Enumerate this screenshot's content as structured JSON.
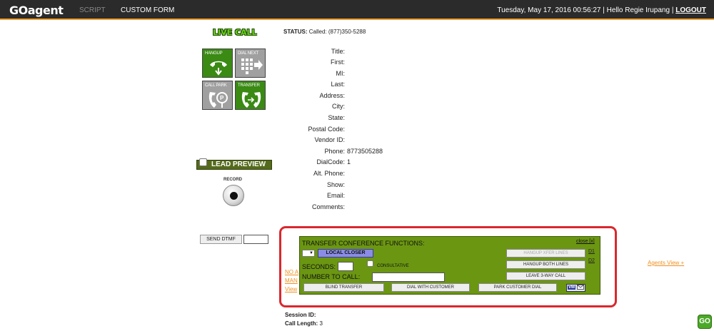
{
  "header": {
    "logo": "GOagent",
    "nav": {
      "script": "SCRIPT",
      "custom_form": "CUSTOM FORM"
    },
    "datetime": "Tuesday, May 17, 2016 00:56:27",
    "separator": "|",
    "greeting": "Hello Regie Irupang",
    "logout": "LOGOUT"
  },
  "call_status": {
    "badge": "LIVE CALL",
    "status_label": "STATUS:",
    "status_value": "Called: (877)350-5288"
  },
  "call_buttons": [
    {
      "label": "HANGUP",
      "icon": "hangup-phone-icon",
      "enabled": true
    },
    {
      "label": "DIAL NEXT",
      "icon": "dial-next-icon",
      "enabled": false
    },
    {
      "label": "CALL PARK",
      "icon": "call-park-icon",
      "enabled": false
    },
    {
      "label": "TRANSFER",
      "icon": "transfer-call-icon",
      "enabled": true
    }
  ],
  "lead_preview_label": "LEAD PREVIEW",
  "record_label": "RECORD",
  "send_dtmf_label": "SEND DTMF",
  "lead_fields": [
    {
      "label": "Title:",
      "value": ""
    },
    {
      "label": "First:",
      "value": ""
    },
    {
      "label": "MI:",
      "value": ""
    },
    {
      "label": "Last:",
      "value": ""
    },
    {
      "label": "Address:",
      "value": ""
    },
    {
      "label": "City:",
      "value": ""
    },
    {
      "label": "State:",
      "value": ""
    },
    {
      "label": "Postal Code:",
      "value": ""
    },
    {
      "label": "Vendor ID:",
      "value": ""
    },
    {
      "label": "Phone:",
      "value": "8773505288"
    },
    {
      "label": "DialCode:",
      "value": "1"
    },
    {
      "label": "Alt. Phone:",
      "value": ""
    },
    {
      "label": "Show:",
      "value": ""
    },
    {
      "label": "Email:",
      "value": ""
    },
    {
      "label": "Comments:",
      "value": ""
    }
  ],
  "transfer_panel": {
    "title": "TRANSFER CONFERENCE FUNCTIONS:",
    "close": "close [x]",
    "local_closer": "LOCAL CLOSER",
    "seconds_label": "SECONDS:",
    "consultative_label": "CONSULTATIVE",
    "number_to_call_label": "NUMBER TO CALL:",
    "hangup_xfer_lines": "HANGUP XFER LINES",
    "hangup_both_lines": "HANGUP BOTH LINES",
    "leave_3way_call": "LEAVE 3-WAY CALL",
    "blind_transfer": "BLIND TRANSFER",
    "dial_with_customer": "DIAL WITH CUSTOMER",
    "park_customer_dial": "PARK CUSTOMER DIAL",
    "d1": "D1",
    "d2": "D2",
    "vm": "VM"
  },
  "left_partial_links": [
    "NO A",
    "MAN",
    "View"
  ],
  "agents_view_link": "Agents View +",
  "session": {
    "session_id_label": "Session ID:",
    "session_id_value": "",
    "call_length_label": "Call Length:",
    "call_length_value": "3"
  },
  "go_badge": "GO",
  "colors": {
    "accent_orange": "#f0a030",
    "panel_green": "#6b9612",
    "highlight_red": "#d9282e",
    "button_green": "#3a8a14"
  }
}
